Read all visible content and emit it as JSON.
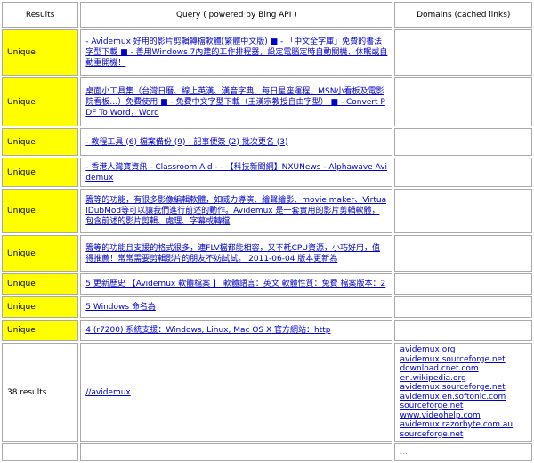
{
  "headers": {
    "results": "Results",
    "query": "Query ( powered by Bing API )",
    "domains": "Domains (cached links)"
  },
  "rows": [
    {
      "status": "Unique",
      "query": "- Avidemux 好用的影片剪輯轉檔軟體(繁體中文版) ■ - 「中文全字庫」免費的書法字型下載 ■ - 善用Windows 7內建的工作排程器，設定電腦定時自動關機、休眠或自動重開機！"
    },
    {
      "status": "Unique",
      "query": "桌面小工具集（台灣日曆、線上英漢、漢音字典、每日星座運程、MSN小看板及電影院看板…）免費使用 ■ - 免費中文字型下載（王漢宗教授自由字型） ■ - Convert PDF To Word，Word"
    },
    {
      "status": "Unique",
      "query": "- 教程工具 (6) 檔案備份 (9) - 記事便簽 (2) 批次更名 (3)"
    },
    {
      "status": "Unique",
      "query": "- 香港人灣寶資訊 - Classroom Aid - - 【科技新聞網】NXUNews - Alphawave Avidemux"
    },
    {
      "status": "Unique",
      "query": "籌等的功能，有很多影像編輯軟體，如威力導演、繪聲繪影、movie maker、VirtualDubMod等可以讓我們進行前述的動作。Avidemux 是一套實用的影片剪輯軟體，包含前述的影片剪輯、處理、字幕或轉檔"
    },
    {
      "status": "Unique",
      "query": "籌等的功能且支援的格式很多，連FLV檔都能相容，又不耗CPU資源，小巧好用，值得推薦！常常需要剪輯影片的朋友不妨試試。 2011-06-04 版本更新為"
    },
    {
      "status": "Unique",
      "query": "5 更新歷史 【Avidemux 軟體檔案 】 軟體語言：英文 軟體性質：免費 檔案版本：2"
    },
    {
      "status": "Unique",
      "query": "5 Windows 命名為"
    },
    {
      "status": "Unique",
      "query": "4 (r7200) 系統支援：Windows, Linux, Mac OS X 官方網站：http"
    }
  ],
  "result_row": {
    "count": "38 results",
    "query": "//avidemux",
    "domains": [
      "avidemux.org",
      "avidemux.sourceforge.net",
      "download.cnet.com",
      "en.wikipedia.org",
      "avidemux.sourceforge.net",
      "avidemux.en.softonic.com",
      "sourceforge.net",
      "www.videohelp.com",
      "avidemux.razorbyte.com.au",
      "sourceforge.net"
    ]
  },
  "partial_row": {
    "domain_fragment": "..."
  }
}
